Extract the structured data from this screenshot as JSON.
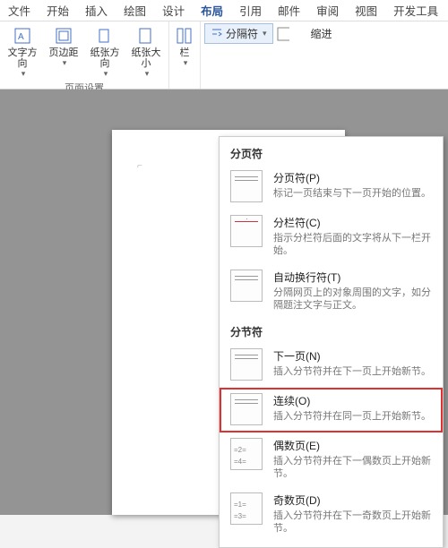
{
  "tabs": [
    "文件",
    "开始",
    "插入",
    "绘图",
    "设计",
    "布局",
    "引用",
    "邮件",
    "审阅",
    "视图",
    "开发工具"
  ],
  "activeTab": "布局",
  "ribbon": {
    "group1": {
      "buttons": [
        {
          "label": "文字方向",
          "icon": "text-direction"
        },
        {
          "label": "页边距",
          "icon": "margins"
        },
        {
          "label": "纸张方向",
          "icon": "orientation"
        },
        {
          "label": "纸张大小",
          "icon": "size"
        }
      ],
      "title": "页面设置"
    },
    "columnsBtn": {
      "label": "栏",
      "icon": "columns"
    },
    "breaksBtn": {
      "label": "分隔符",
      "icon": "breaks"
    },
    "indentLabel": "缩进"
  },
  "dropdown": {
    "section1": {
      "title": "分页符",
      "items": [
        {
          "title": "分页符(P)",
          "desc": "标记一页结束与下一页开始的位置。"
        },
        {
          "title": "分栏符(C)",
          "desc": "指示分栏符后面的文字将从下一栏开始。"
        },
        {
          "title": "自动换行符(T)",
          "desc": "分隔网页上的对象周围的文字，如分隔题注文字与正文。"
        }
      ]
    },
    "section2": {
      "title": "分节符",
      "items": [
        {
          "title": "下一页(N)",
          "desc": "插入分节符并在下一页上开始新节。"
        },
        {
          "title": "连续(O)",
          "desc": "插入分节符并在同一页上开始新节。"
        },
        {
          "title": "偶数页(E)",
          "desc": "插入分节符并在下一偶数页上开始新节。"
        },
        {
          "title": "奇数页(D)",
          "desc": "插入分节符并在下一奇数页上开始新节。"
        }
      ]
    }
  }
}
